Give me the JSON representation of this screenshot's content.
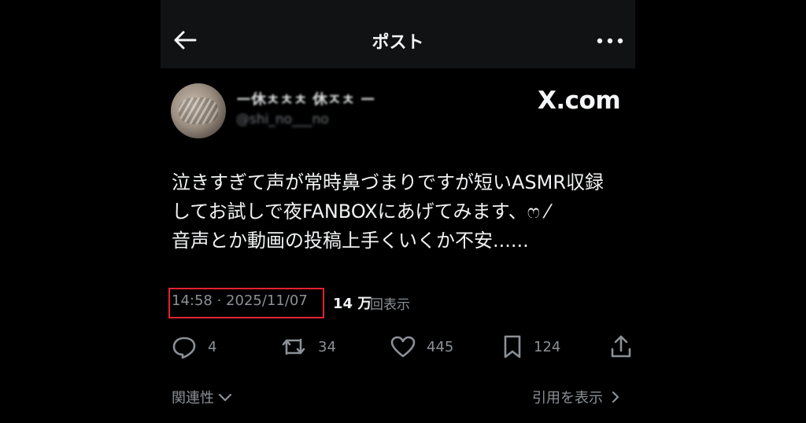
{
  "header": {
    "title": "ポスト"
  },
  "author": {
    "name": "ー休ㅊㅊㅊ 休ㅈㅊ ー",
    "handle": "@shi_no___no"
  },
  "brand": "X.com",
  "post": {
    "lines": [
      "泣きすぎて声が常時鼻づまりですが短いASMR収録",
      "してお試しで夜FANBOXにあげてみます、ෆ ⁄",
      "音声とか動画の投稿上手くいくか不安......"
    ],
    "timestamp": "14:58 · 2025/11/07",
    "views_count": "14 万",
    "views_label": "回表示"
  },
  "actions": {
    "replies": "4",
    "reposts": "34",
    "likes": "445",
    "bookmarks": "124"
  },
  "footer": {
    "related": "関連性",
    "quotes": "引用を表示"
  },
  "colors": {
    "background": "#000000",
    "header_bg": "#111214",
    "secondary_text": "#8b9096",
    "highlight_box": "#e3232c"
  }
}
